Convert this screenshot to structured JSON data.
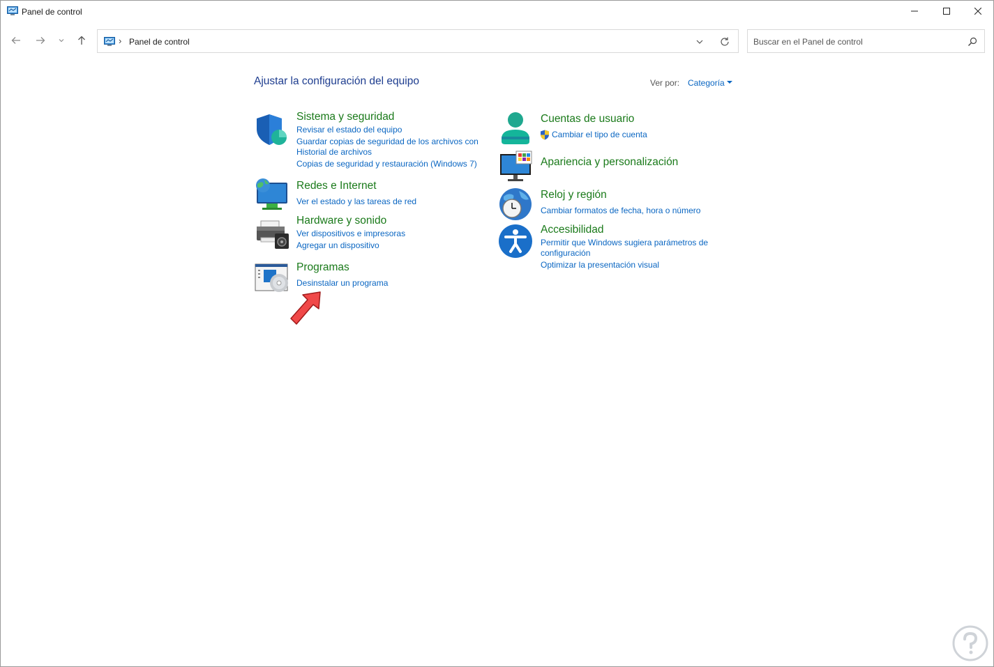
{
  "window": {
    "title": "Panel de control"
  },
  "address": {
    "path": "Panel de control",
    "separator": "›"
  },
  "search": {
    "placeholder": "Buscar en el Panel de control"
  },
  "page": {
    "heading": "Ajustar la configuración del equipo",
    "view_by_label": "Ver por:",
    "view_by_value": "Categoría"
  },
  "categories": {
    "sistema": {
      "title": "Sistema y seguridad",
      "links": [
        "Revisar el estado del equipo",
        "Guardar copias de seguridad de los archivos con",
        "Historial de archivos",
        "Copias de seguridad y restauración (Windows 7)"
      ],
      "icon": "shield-icon"
    },
    "redes": {
      "title": "Redes e Internet",
      "links": [
        "Ver el estado y las tareas de red"
      ],
      "icon": "network-icon"
    },
    "hardware": {
      "title": "Hardware y sonido",
      "links": [
        "Ver dispositivos e impresoras",
        "Agregar un dispositivo"
      ],
      "icon": "printer-icon"
    },
    "programas": {
      "title": "Programas",
      "links": [
        "Desinstalar un programa"
      ],
      "icon": "programs-icon"
    },
    "cuentas": {
      "title": "Cuentas de usuario",
      "links": [
        "Cambiar el tipo de cuenta"
      ],
      "icon": "user-icon"
    },
    "apariencia": {
      "title": "Apariencia y personalización",
      "links": [],
      "icon": "monitor-palette-icon"
    },
    "reloj": {
      "title": "Reloj y región",
      "links": [
        "Cambiar formatos de fecha, hora o número"
      ],
      "icon": "clock-globe-icon"
    },
    "accesibilidad": {
      "title": "Accesibilidad",
      "links": [
        "Permitir que Windows sugiera parámetros de",
        "configuración",
        "Optimizar la presentación visual"
      ],
      "icon": "accessibility-icon"
    }
  },
  "colors": {
    "heading": "#1e3d8f",
    "category_title": "#1a7a1a",
    "link": "#0a66c2",
    "annotation_arrow": "#f04848"
  }
}
